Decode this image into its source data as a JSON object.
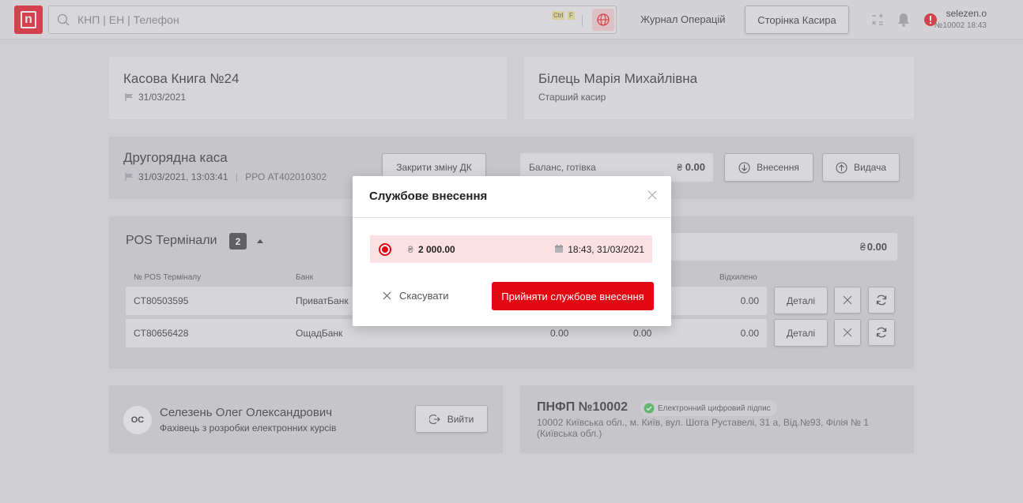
{
  "topbar": {
    "logo_letter": "n",
    "search_placeholder": "КНП | ЕН | Телефон",
    "kbd_ctrl": "Ctrl",
    "kbd_f": "F",
    "journal_link": "Журнал Операцій",
    "cashier_page_button": "Сторінка Касира",
    "user_name": "selezen.o",
    "user_sub": "№10002 18:43",
    "alert_badge": "!"
  },
  "cashbook": {
    "title": "Касова Книга №24",
    "date": "31/03/2021"
  },
  "cashier": {
    "name": "Білець Марія Михайлівна",
    "role": "Старший касир"
  },
  "secondary": {
    "title": "Другорядна каса",
    "datetime": "31/03/2021, 13:03:41",
    "separator": "|",
    "rro": "РРО АТ402010302",
    "close_shift_button": "Закрити зміну ДК",
    "balance_label": "Баланс, готівка",
    "balance_currency": "₴",
    "balance_value": "0.00",
    "deposit_button": "Внесення",
    "withdraw_button": "Видача"
  },
  "pos": {
    "title": "POS Термінали",
    "count": "2",
    "total_currency": "₴",
    "total_value": "0.00",
    "columns": [
      "№ POS Терміналу",
      "Банк",
      "Відхилено"
    ],
    "details_button": "Деталі",
    "rows": [
      {
        "id": "CT80503595",
        "bank": "ПриватБанк",
        "v1": "",
        "v2": "",
        "rejected": "0.00"
      },
      {
        "id": "CT80656428",
        "bank": "ОщадБанк",
        "v1": "0.00",
        "v2": "0.00",
        "rejected": "0.00"
      }
    ]
  },
  "employee": {
    "initials": "ОС",
    "name": "Селезень Олег Олександрович",
    "position": "Фахівець з розробки електронних курсів",
    "logout_button": "Вийти"
  },
  "pnfp": {
    "title": "ПНФП №10002",
    "signature_badge": "Електронний цифровий підпис",
    "address": "10002 Київська обл., м. Київ, вул. Шота Руставелі, 31 а, Від.№93, Філія № 1 (Київська обл.)"
  },
  "modal": {
    "title": "Службове внесення",
    "currency": "₴",
    "amount": "2 000.00",
    "datetime": "18:43, 31/03/2021",
    "cancel_button": "Скасувати",
    "accept_button": "Прийняти службове внесення"
  },
  "colors": {
    "brand_red": "#e30613",
    "background": "#dcdcde",
    "card": "#e8e8ea",
    "card_dark": "#cfcfd3",
    "signature_green": "#3bb54a"
  }
}
